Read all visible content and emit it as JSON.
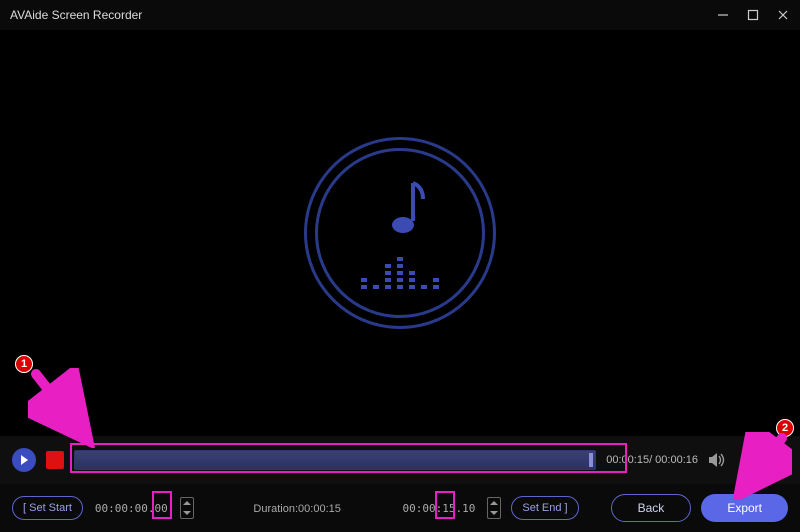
{
  "app": {
    "title": "AVAide Screen Recorder"
  },
  "playback": {
    "timecode": "00:00:15/ 00:00:16"
  },
  "trim": {
    "set_start_label": "[ Set Start",
    "start_time": "00:00:00.00",
    "duration_label": "Duration:",
    "duration_value": "00:00:15",
    "end_time": "00:00:15.10",
    "set_end_label": "Set End ]"
  },
  "actions": {
    "back_label": "Back",
    "export_label": "Export"
  },
  "annotations": {
    "n1": "1",
    "n2": "2"
  }
}
